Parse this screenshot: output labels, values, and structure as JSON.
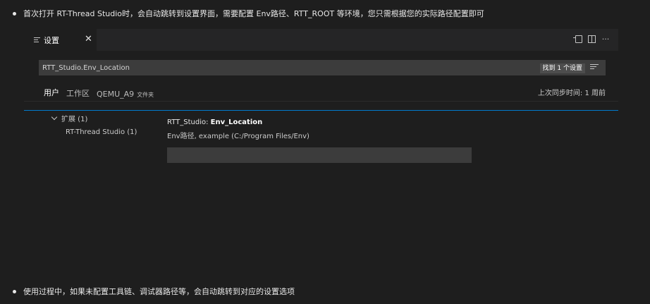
{
  "bullets": [
    "首次打开 RT-Thread Studio时，会自动跳转到设置界面，需要配置 Env路径、RTT_ROOT 等环境，您只需根据您的实际路径配置即可",
    "使用过程中，如果未配置工具链、调试器路径等，会自动跳转到对应的设置选项"
  ],
  "editor": {
    "tab": {
      "label": "设置",
      "close": "✕",
      "icon": "list-icon"
    },
    "actions": [
      {
        "name": "open-json-icon"
      },
      {
        "name": "split-editor-icon"
      },
      {
        "name": "more-actions-icon",
        "glyph": "···"
      }
    ]
  },
  "search": {
    "value": "RTT_Studio.Env_Location",
    "result_count": "找到 1 个设置",
    "filter_icon": "filter-icon"
  },
  "scope": {
    "tabs": [
      {
        "label": "用户",
        "active": true
      },
      {
        "label": "工作区",
        "active": false
      },
      {
        "label": "QEMU_A9",
        "suffix": "文件夹",
        "active": false
      }
    ],
    "sync": "上次同步时间: 1 周前"
  },
  "toc": {
    "group": "扩展 (1)",
    "child": "RT-Thread Studio (1)"
  },
  "setting": {
    "category": "RTT_Studio: ",
    "name": "Env_Location",
    "description": "Env路径, example (C:/Program Files/Env)",
    "value": ""
  },
  "colors": {
    "background": "#1e1e1e",
    "accent": "#007acc",
    "input": "#3c3c3c"
  }
}
